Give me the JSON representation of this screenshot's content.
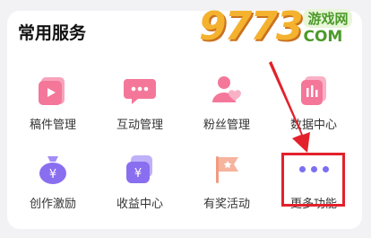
{
  "section": {
    "title": "常用服务"
  },
  "services": [
    {
      "label": "稿件管理",
      "icon": "manuscript-icon"
    },
    {
      "label": "互动管理",
      "icon": "chat-bubble-icon"
    },
    {
      "label": "粉丝管理",
      "icon": "fans-icon"
    },
    {
      "label": "数据中心",
      "icon": "data-chart-icon"
    },
    {
      "label": "创作激励",
      "icon": "money-bag-icon"
    },
    {
      "label": "收益中心",
      "icon": "wallet-icon"
    },
    {
      "label": "有奖活动",
      "icon": "flag-icon"
    },
    {
      "label": "更多功能",
      "icon": "more-dots-icon"
    }
  ],
  "watermark": {
    "digits": "9773",
    "cn": "游戏网",
    "com": "COM"
  },
  "colors": {
    "pink": "#f4779a",
    "purple": "#8a6ef0",
    "peach": "#f29a7f",
    "highlight": "#e3212b"
  }
}
